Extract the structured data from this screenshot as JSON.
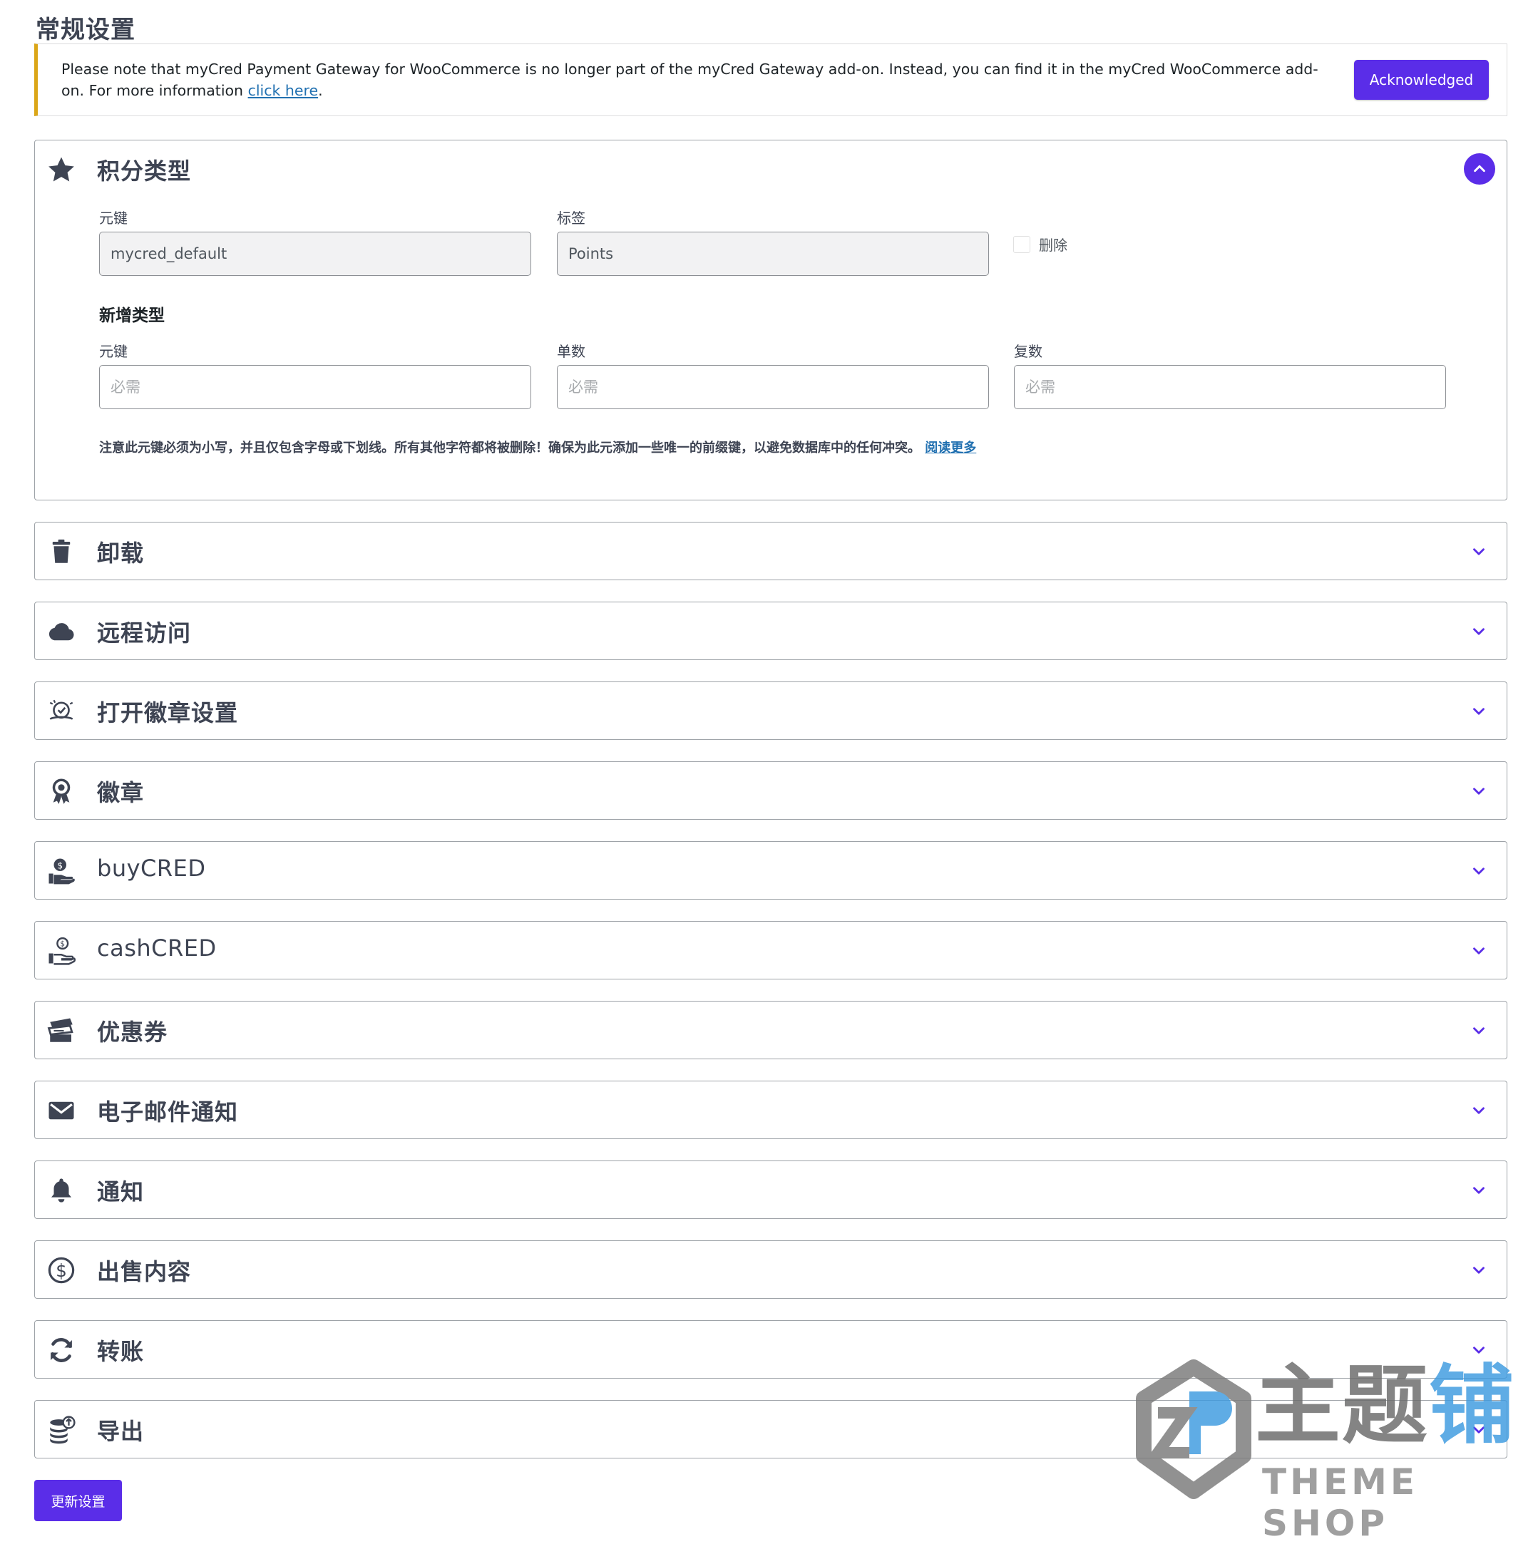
{
  "page": {
    "title": "常规设置"
  },
  "notice": {
    "text": "Please note that myCred Payment Gateway for WooCommerce is no longer part of the myCred Gateway add-on. Instead, you can find it in the myCred WooCommerce add-on. For more information ",
    "link": "click here",
    "suffix": ".",
    "button": "Acknowledged"
  },
  "point_types": {
    "title": "积分类型",
    "key_label": "元键",
    "key_value": "mycred_default",
    "label_label": "标签",
    "label_value": "Points",
    "delete_label": "删除",
    "new_type_title": "新增类型",
    "new_key_label": "元键",
    "singular_label": "单数",
    "plural_label": "复数",
    "placeholder": "必需",
    "note": "注意此元键必须为小写，并且仅包含字母或下划线。所有其他字符都将被删除！确保为此元添加一些唯一的前缀键，以避免数据库中的任何冲突。",
    "note_link": "阅读更多"
  },
  "sections": [
    {
      "title": "卸载",
      "icon": "trash-icon"
    },
    {
      "title": "远程访问",
      "icon": "cloud-icon"
    },
    {
      "title": "打开徽章设置",
      "icon": "open-badge-icon"
    },
    {
      "title": "徽章",
      "icon": "award-icon"
    },
    {
      "title": "buyCRED",
      "icon": "buy-cred-icon"
    },
    {
      "title": "cashCRED",
      "icon": "cash-cred-icon"
    },
    {
      "title": "优惠券",
      "icon": "coupon-icon"
    },
    {
      "title": "电子邮件通知",
      "icon": "envelope-icon"
    },
    {
      "title": "通知",
      "icon": "bell-icon"
    },
    {
      "title": "出售内容",
      "icon": "dollar-icon"
    },
    {
      "title": "转账",
      "icon": "transfer-icon"
    },
    {
      "title": "导出",
      "icon": "export-icon"
    }
  ],
  "footer": {
    "update_button": "更新设置"
  },
  "watermark": {
    "cn_main": "主题",
    "cn_blue": "铺",
    "en": "THEME SHOP"
  },
  "colors": {
    "accent": "#5a2de8",
    "notice_border": "#dba617",
    "link": "#2271b1",
    "icon": "#3e4453"
  }
}
